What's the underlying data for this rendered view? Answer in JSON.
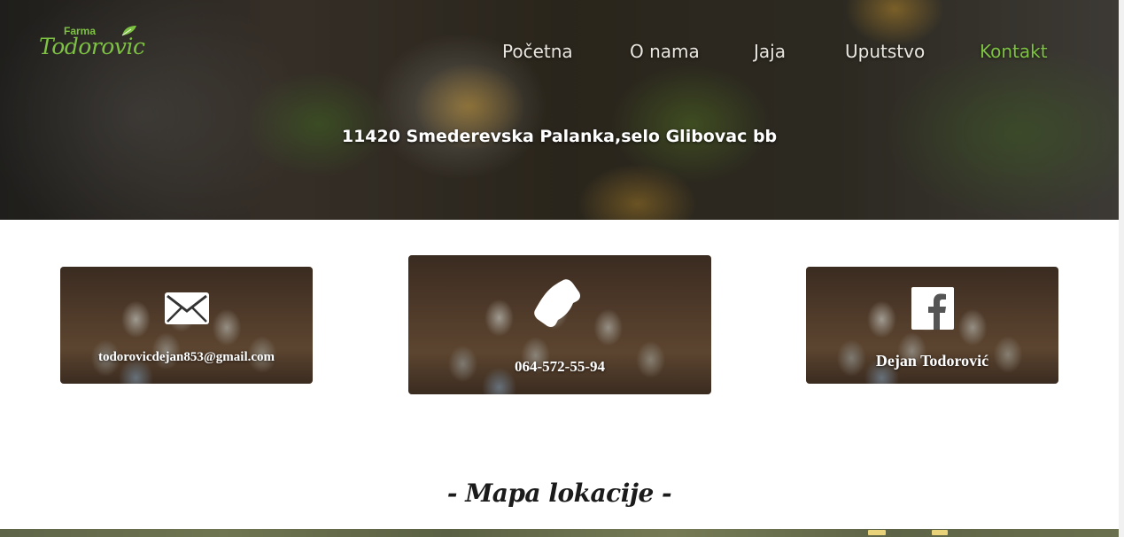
{
  "brand": {
    "top": "Farma",
    "name": "Todorovic"
  },
  "nav": {
    "items": [
      {
        "label": "Početna"
      },
      {
        "label": "O nama"
      },
      {
        "label": "Jaja"
      },
      {
        "label": "Uputstvo"
      },
      {
        "label": "Kontakt",
        "active": true
      }
    ]
  },
  "hero": {
    "address": "11420 Smederevska Palanka,selo Glibovac bb"
  },
  "contacts": {
    "email": {
      "icon": "envelope-icon",
      "text": "todorovicdejan853@gmail.com"
    },
    "phone": {
      "icon": "phone-icon",
      "text": "064-572-55-94"
    },
    "facebook": {
      "icon": "facebook-icon",
      "text": "Dejan Todorović"
    }
  },
  "map": {
    "title": "- Mapa lokacije -"
  },
  "colors": {
    "accent": "#7dc242",
    "nav_text": "#e9e6e0",
    "title_text": "#1b1b1b"
  }
}
